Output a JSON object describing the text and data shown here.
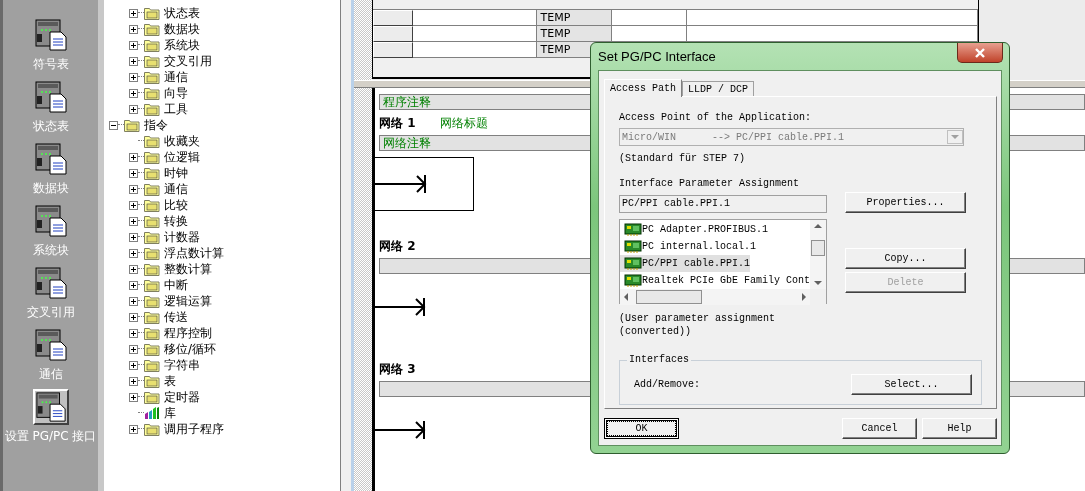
{
  "sidebar": {
    "items": [
      {
        "label": "符号表",
        "selected": false
      },
      {
        "label": "状态表",
        "selected": false
      },
      {
        "label": "数据块",
        "selected": false
      },
      {
        "label": "系统块",
        "selected": false
      },
      {
        "label": "交叉引用",
        "selected": false
      },
      {
        "label": "通信",
        "selected": false
      },
      {
        "label": "设置 PG/PC 接口",
        "selected": true
      }
    ]
  },
  "tree": {
    "upper_branch_items": [
      {
        "label": "状态表",
        "kind": "folder",
        "has_children": true,
        "expanded": false
      },
      {
        "label": "数据块",
        "kind": "folder",
        "has_children": true,
        "expanded": false
      },
      {
        "label": "系统块",
        "kind": "folder",
        "has_children": true,
        "expanded": false
      },
      {
        "label": "交叉引用",
        "kind": "folder",
        "has_children": true,
        "expanded": false
      },
      {
        "label": "通信",
        "kind": "folder",
        "has_children": true,
        "expanded": false
      },
      {
        "label": "向导",
        "kind": "folder",
        "has_children": true,
        "expanded": false
      },
      {
        "label": "工具",
        "kind": "folder",
        "has_children": true,
        "expanded": false
      }
    ],
    "items": [
      {
        "label": "指令",
        "kind": "folder",
        "has_children": true,
        "expanded": true,
        "children": [
          {
            "label": "收藏夹",
            "kind": "folder",
            "has_children": false
          },
          {
            "label": "位逻辑",
            "kind": "folder",
            "has_children": true,
            "expanded": false
          },
          {
            "label": "时钟",
            "kind": "folder",
            "has_children": true,
            "expanded": false
          },
          {
            "label": "通信",
            "kind": "folder",
            "has_children": true,
            "expanded": false
          },
          {
            "label": "比较",
            "kind": "folder",
            "has_children": true,
            "expanded": false
          },
          {
            "label": "转换",
            "kind": "folder",
            "has_children": true,
            "expanded": false
          },
          {
            "label": "计数器",
            "kind": "folder",
            "has_children": true,
            "expanded": false
          },
          {
            "label": "浮点数计算",
            "kind": "folder",
            "has_children": true,
            "expanded": false
          },
          {
            "label": "整数计算",
            "kind": "folder",
            "has_children": true,
            "expanded": false
          },
          {
            "label": "中断",
            "kind": "folder",
            "has_children": true,
            "expanded": false
          },
          {
            "label": "逻辑运算",
            "kind": "folder",
            "has_children": true,
            "expanded": false
          },
          {
            "label": "传送",
            "kind": "folder",
            "has_children": true,
            "expanded": false
          },
          {
            "label": "程序控制",
            "kind": "folder",
            "has_children": true,
            "expanded": false
          },
          {
            "label": "移位/循环",
            "kind": "folder",
            "has_children": true,
            "expanded": false
          },
          {
            "label": "字符串",
            "kind": "folder",
            "has_children": true,
            "expanded": false
          },
          {
            "label": "表",
            "kind": "folder",
            "has_children": true,
            "expanded": false
          },
          {
            "label": "定时器",
            "kind": "folder",
            "has_children": true,
            "expanded": false
          },
          {
            "label": "库",
            "kind": "library",
            "has_children": false
          },
          {
            "label": "调用子程序",
            "kind": "folder",
            "has_children": true,
            "expanded": false
          }
        ]
      }
    ]
  },
  "variable_table": {
    "rows": [
      {
        "column_3": "TEMP"
      },
      {
        "column_3": "TEMP"
      },
      {
        "column_3": "TEMP"
      }
    ]
  },
  "program_comment": "程序注释",
  "networks": [
    {
      "label": "网络 1",
      "title": "网络标题",
      "comment": "网络注释",
      "cursor": true
    },
    {
      "label": "网络 2",
      "cursor": false
    },
    {
      "label": "网络 3",
      "cursor": false
    }
  ],
  "dialog": {
    "title": "Set PG/PC Interface",
    "tabs": [
      {
        "label": "Access Path",
        "selected": true
      },
      {
        "label": "LLDP / DCP",
        "selected": false
      }
    ],
    "access_point": {
      "label": "Access Point of the Application:",
      "value": "Micro/WIN      --> PC/PPI cable.PPI.1",
      "disabled": true
    },
    "access_point_note": "(Standard für STEP 7)",
    "parameter_assignment": {
      "label": "Interface Parameter Assignment",
      "value": "PC/PPI cable.PPI.1"
    },
    "properties_button": {
      "label": "Properties...",
      "disabled": false
    },
    "interfaces_list": [
      {
        "label": "PC Adapter.PROFIBUS.1",
        "selected": false
      },
      {
        "label": "PC internal.local.1",
        "selected": false
      },
      {
        "label": "PC/PPI cable.PPI.1",
        "selected": true
      },
      {
        "label": "Realtek PCIe GbE Family Cont",
        "selected": false
      }
    ],
    "list_buttons": [
      {
        "label": "Copy...",
        "disabled": false
      },
      {
        "label": "Delete",
        "disabled": true
      }
    ],
    "assignment_note": "(User parameter assignment\n(converted))",
    "interfaces_group": {
      "title": "Interfaces",
      "label": "Add/Remove:",
      "button": "Select..."
    },
    "buttons": [
      {
        "label": "OK",
        "focused": true
      },
      {
        "label": "Cancel",
        "focused": false
      },
      {
        "label": "Help",
        "focused": false
      }
    ]
  }
}
